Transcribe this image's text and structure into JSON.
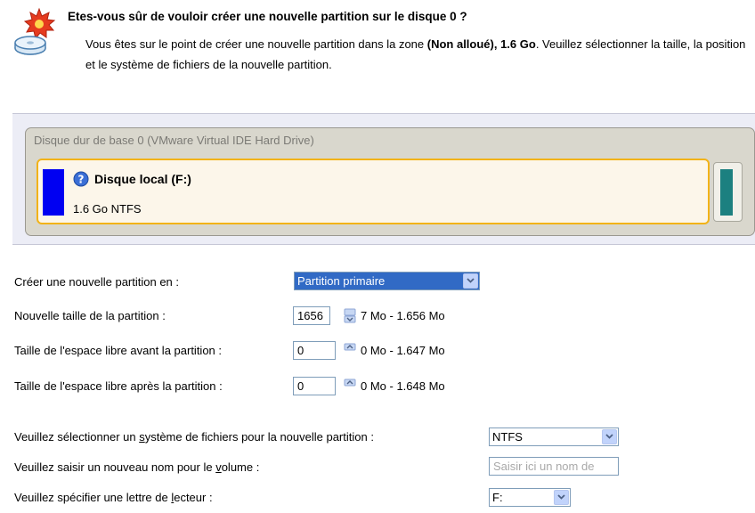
{
  "header": {
    "title": "Etes-vous sûr de vouloir créer une nouvelle partition sur le disque 0 ?",
    "desc_part1": "Vous êtes sur le point de créer une nouvelle partition dans la zone ",
    "desc_bold": "(Non alloué), 1.6 Go",
    "desc_part2": ". Veuillez sélectionner la taille, la position et le système de fichiers de la nouvelle partition.",
    "icon": "wizard-partition-icon"
  },
  "disk": {
    "header": "Disque dur de base 0 (VMware Virtual IDE Hard Drive)",
    "partition_name": "Disque local (F:)",
    "partition_info": "1.6 Go NTFS",
    "partition_color": "#0000f2",
    "free_color": "#1c8080"
  },
  "form": {
    "create_label": "Créer une nouvelle partition en :",
    "create_value": "Partition primaire",
    "size_label": "Nouvelle taille de la partition :",
    "size_value": "1656",
    "size_range": "7 Mo - 1.656 Mo",
    "before_label": "Taille de l'espace libre avant la partition :",
    "before_value": "0",
    "before_range": "0 Mo - 1.647 Mo",
    "after_label": "Taille de l'espace libre après la partition :",
    "after_value": "0",
    "after_range": "0 Mo - 1.648 Mo",
    "fs_label_pre": "Veuillez sélectionner un ",
    "fs_label_u": "s",
    "fs_label_post": "ystème de fichiers pour la nouvelle partition :",
    "fs_value": "NTFS",
    "vol_label_pre": "Veuillez saisir un nouveau nom pour le ",
    "vol_label_u": "v",
    "vol_label_post": "olume :",
    "vol_placeholder": "Saisir ici un nom de",
    "letter_label_pre": "Veuillez spécifier une lettre de ",
    "letter_label_u": "l",
    "letter_label_post": "ecteur :",
    "letter_value": "F:"
  }
}
